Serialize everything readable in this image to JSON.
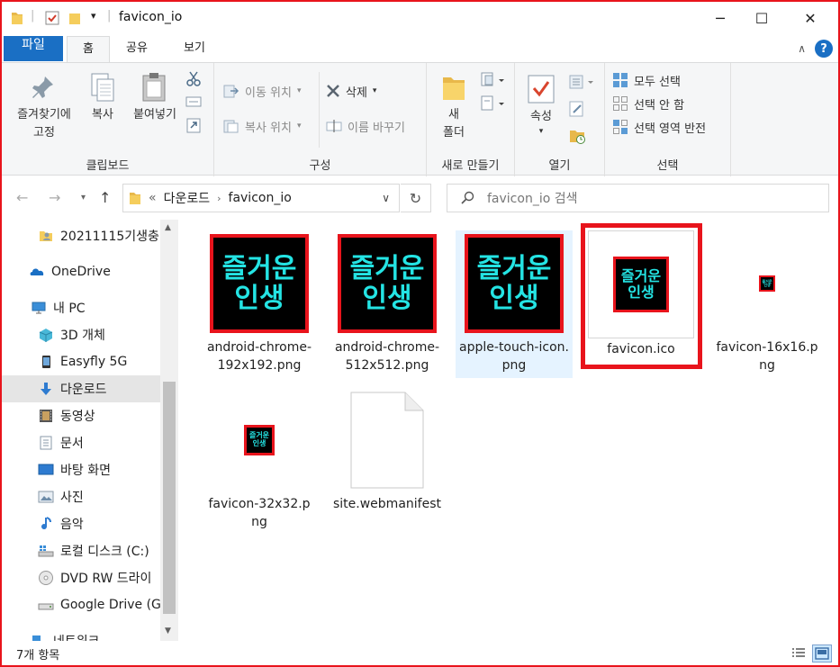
{
  "window": {
    "title": "favicon_io",
    "controls": {
      "minimize": "─",
      "maximize": "☐",
      "close": "✕"
    }
  },
  "ribbon_tabs": [
    {
      "label": "파일"
    },
    {
      "label": "홈"
    },
    {
      "label": "공유"
    },
    {
      "label": "보기"
    }
  ],
  "ribbon": {
    "clipboard": {
      "label": "클립보드",
      "pin": "즐겨찾기에\n고정",
      "copy": "복사",
      "paste": "붙여넣기"
    },
    "organize": {
      "label": "구성",
      "move_to": "이동 위치",
      "copy_to": "복사 위치",
      "delete": "삭제",
      "rename": "이름 바꾸기"
    },
    "new": {
      "label": "새로 만들기",
      "new_folder": "새\n폴더"
    },
    "open": {
      "label": "열기",
      "properties": "속성"
    },
    "select": {
      "label": "선택",
      "select_all": "모두 선택",
      "select_none": "선택 안 함",
      "invert": "선택 영역 반전"
    }
  },
  "address": {
    "prefix": "«",
    "crumbs": [
      "다운로드",
      "favicon_io"
    ],
    "search_placeholder": "favicon_io 검색"
  },
  "sidebar": {
    "items": [
      {
        "label": "20211115기생충",
        "icon": "folder-user-icon"
      },
      {
        "label": "OneDrive",
        "icon": "onedrive-icon"
      },
      {
        "label": "내 PC",
        "icon": "pc-icon"
      },
      {
        "label": "3D 개체",
        "icon": "3d-objects-icon"
      },
      {
        "label": "Easyfly 5G",
        "icon": "phone-icon"
      },
      {
        "label": "다운로드",
        "icon": "download-icon",
        "selected": true
      },
      {
        "label": "동영상",
        "icon": "video-icon"
      },
      {
        "label": "문서",
        "icon": "document-icon"
      },
      {
        "label": "바탕 화면",
        "icon": "desktop-icon"
      },
      {
        "label": "사진",
        "icon": "pictures-icon"
      },
      {
        "label": "음악",
        "icon": "music-icon"
      },
      {
        "label": "로컬 디스크 (C:)",
        "icon": "drive-icon"
      },
      {
        "label": "DVD RW 드라이",
        "icon": "dvd-icon"
      },
      {
        "label": "Google Drive (G",
        "icon": "google-drive-icon"
      },
      {
        "label": "네트워크",
        "icon": "network-icon"
      }
    ]
  },
  "icon_text": {
    "line1": "즐거운",
    "line2": "인생"
  },
  "files": [
    {
      "name": "android-chrome-192x192.png",
      "kind": "large"
    },
    {
      "name": "android-chrome-512x512.png",
      "kind": "large"
    },
    {
      "name": "apple-touch-icon.png",
      "kind": "large",
      "hover": true
    },
    {
      "name": "favicon.ico",
      "kind": "ico",
      "highlighted": true
    },
    {
      "name": "favicon-16x16.png",
      "kind": "tiny"
    },
    {
      "name": "favicon-32x32.png",
      "kind": "small"
    },
    {
      "name": "site.webmanifest",
      "kind": "blank"
    }
  ],
  "status": {
    "count": "7개 항목"
  },
  "colors": {
    "accent": "#1a6fc4",
    "highlight": "#e8141c",
    "icon_text": "#24e4e4"
  }
}
